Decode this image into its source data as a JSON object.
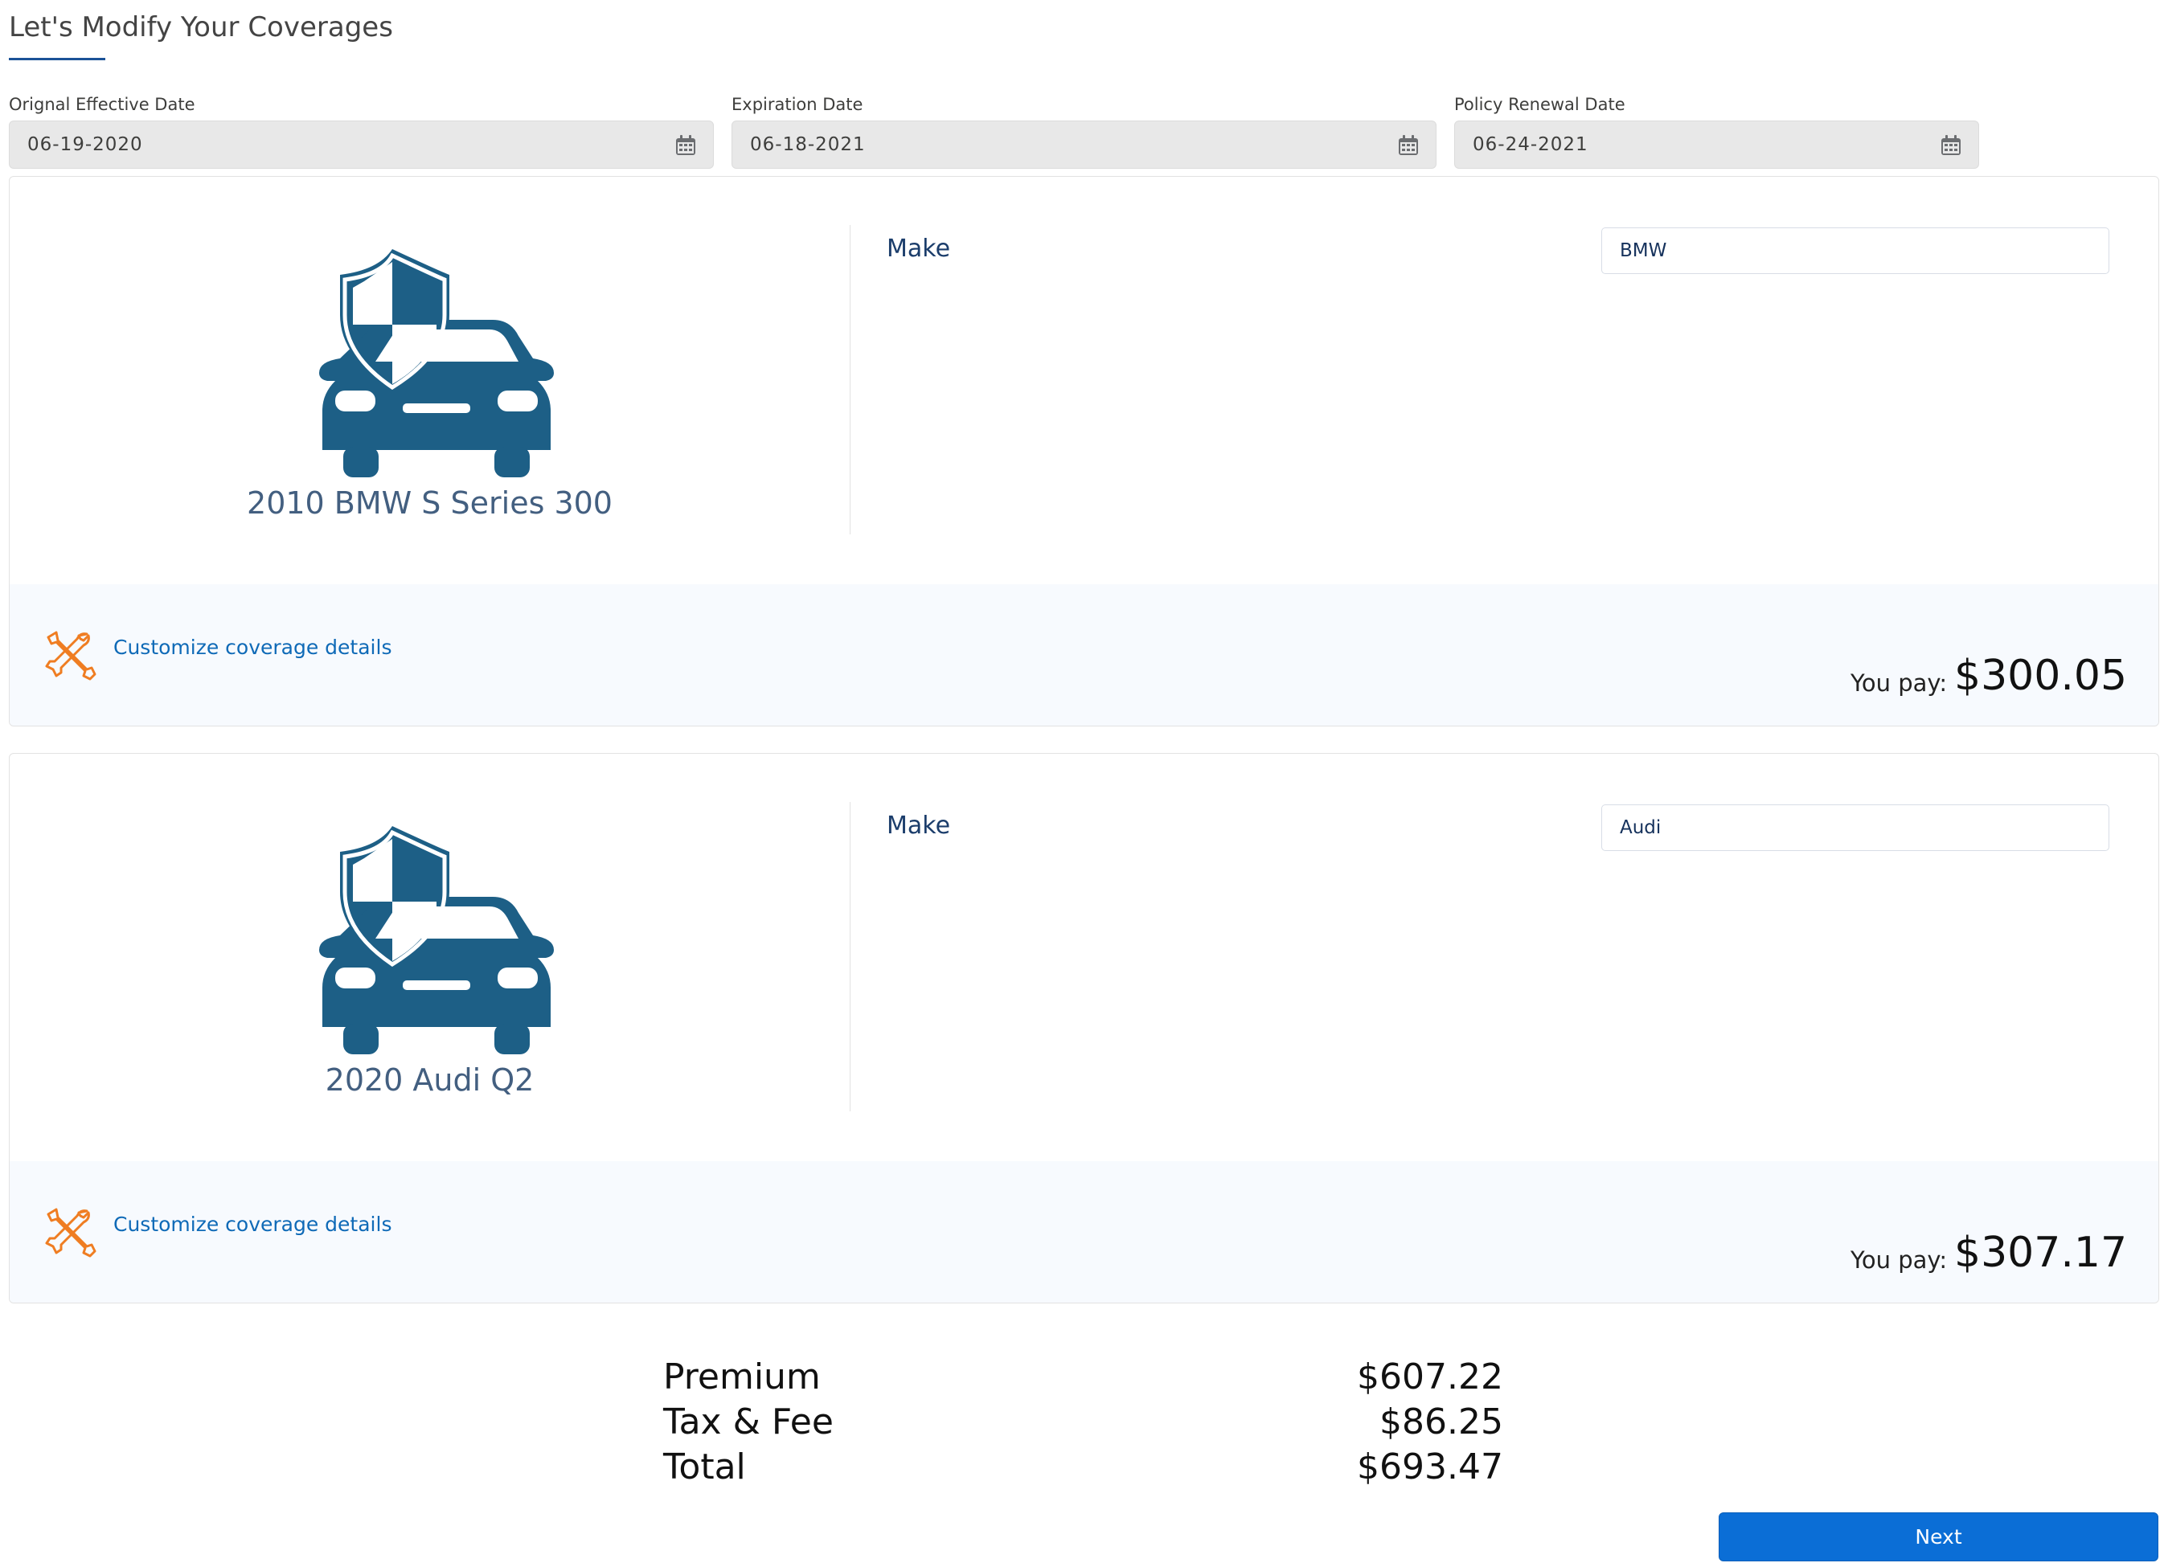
{
  "page": {
    "title": "Let's Modify Your Coverages"
  },
  "dates": [
    {
      "label": "Orignal Effective Date",
      "value": "06-19-2020",
      "icon": "calendar-icon"
    },
    {
      "label": "Expiration Date",
      "value": "06-18-2021",
      "icon": "calendar-icon"
    },
    {
      "label": "Policy Renewal Date",
      "value": "06-24-2021",
      "icon": "calendar-icon"
    }
  ],
  "vehicles": [
    {
      "name": "2010 BMW S Series 300",
      "make_label": "Make",
      "make_value": "BMW",
      "customize_label": "Customize coverage details",
      "you_pay_label": "You pay:",
      "you_pay_amount": "$300.05"
    },
    {
      "name": "2020 Audi Q2",
      "make_label": "Make",
      "make_value": "Audi",
      "customize_label": "Customize coverage details",
      "you_pay_label": "You pay:",
      "you_pay_amount": "$307.17"
    }
  ],
  "summary": {
    "premium_label": "Premium",
    "premium_value": "$607.22",
    "tax_label": "Tax & Fee",
    "tax_value": "$86.25",
    "total_label": "Total",
    "total_value": "$693.47"
  },
  "actions": {
    "next_label": "Next"
  },
  "colors": {
    "accent": "#0b6ed6",
    "title_underline": "#1b5297",
    "car_icon": "#1d5f86",
    "tools_icon": "#ef7d22",
    "link": "#0f6ab7"
  },
  "icons": {
    "vehicle": "car-shield-icon",
    "customize": "tools-icon"
  }
}
